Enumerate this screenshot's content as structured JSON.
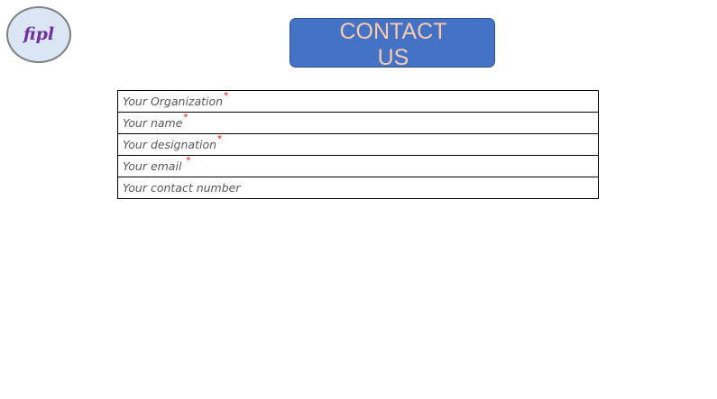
{
  "logo": {
    "text": "fipl"
  },
  "header": {
    "contact_label": "CONTACT US"
  },
  "form": {
    "fields": [
      {
        "placeholder": "Your Organization",
        "required_mark": "*"
      },
      {
        "placeholder": "Your name",
        "required_mark": "*"
      },
      {
        "placeholder": "Your designation",
        "required_mark": "*"
      },
      {
        "placeholder": "Your email ",
        "required_mark": "*"
      },
      {
        "placeholder": "Your contact number",
        "required_mark": ""
      }
    ]
  },
  "colors": {
    "logo_fill": "#dbe6f4",
    "logo_text": "#7030a0",
    "button_fill": "#4472c4",
    "button_text": "#f8cbad",
    "required_mark": "#ff0000"
  }
}
